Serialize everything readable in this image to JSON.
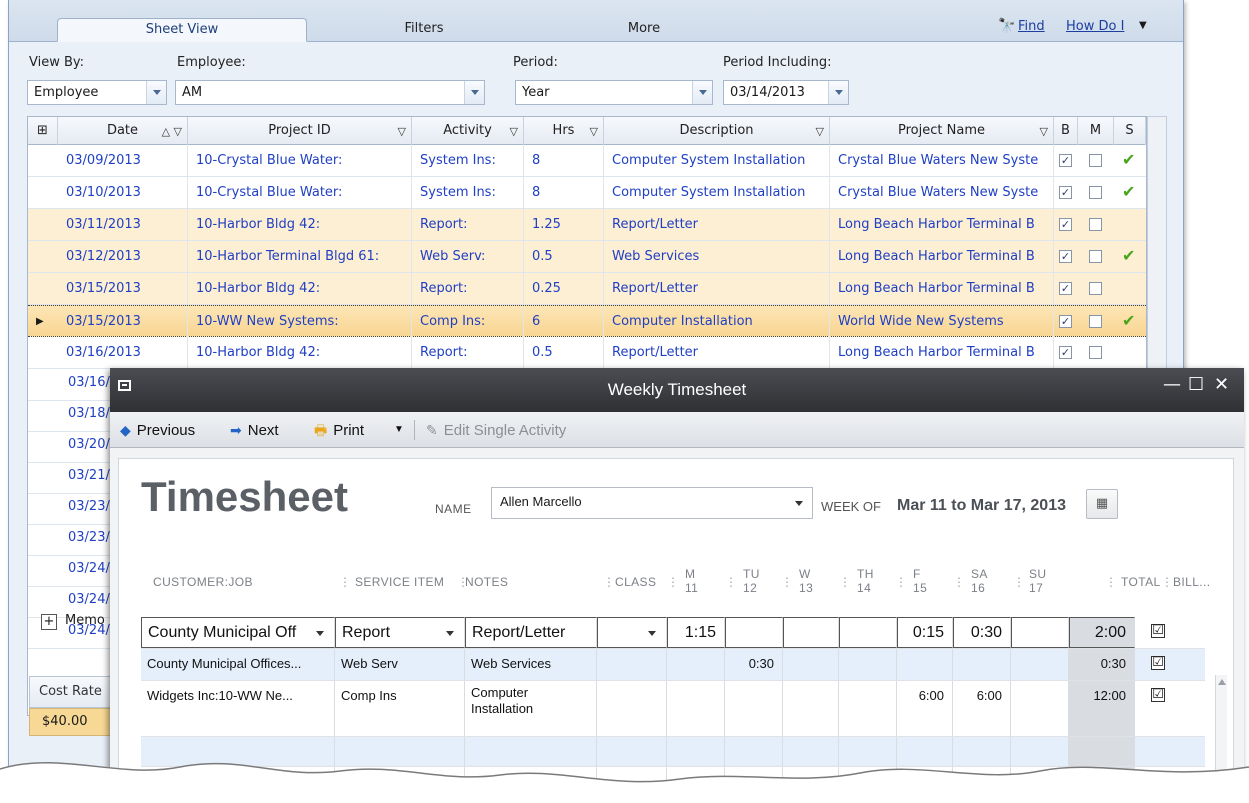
{
  "back": {
    "tabs": [
      "Sheet View",
      "Filters",
      "More"
    ],
    "find_label": "Find",
    "howdoi_label": "How Do I",
    "filters": {
      "view_by_label": "View By:",
      "view_by_value": "Employee",
      "employee_label": "Employee:",
      "employee_value": "AM",
      "period_label": "Period:",
      "period_value": "Year",
      "period_incl_label": "Period Including:",
      "period_incl_value": "03/14/2013"
    },
    "columns": [
      "Date",
      "Project ID",
      "Activity",
      "Hrs",
      "Description",
      "Project Name",
      "B",
      "M",
      "S"
    ],
    "rows": [
      {
        "date": "03/09/2013",
        "project_id": "10-Crystal Blue Water:",
        "activity": "System Ins:",
        "hrs": "8",
        "description": "Computer System Installation",
        "project_name": "Crystal Blue Waters New Syste"
      },
      {
        "date": "03/10/2013",
        "project_id": "10-Crystal Blue Water:",
        "activity": "System Ins:",
        "hrs": "8",
        "description": "Computer System Installation",
        "project_name": "Crystal Blue Waters New Syste"
      },
      {
        "date": "03/11/2013",
        "project_id": "10-Harbor Bldg 42:",
        "activity": "Report:",
        "hrs": "1.25",
        "description": "Report/Letter",
        "project_name": "Long Beach Harbor Terminal B"
      },
      {
        "date": "03/12/2013",
        "project_id": "10-Harbor Terminal Blgd 61:",
        "activity": "Web Serv:",
        "hrs": "0.5",
        "description": "Web Services",
        "project_name": "Long Beach Harbor Terminal B"
      },
      {
        "date": "03/15/2013",
        "project_id": "10-Harbor Bldg 42:",
        "activity": "Report:",
        "hrs": "0.25",
        "description": "Report/Letter",
        "project_name": "Long Beach Harbor Terminal B"
      },
      {
        "date": "03/15/2013",
        "project_id": "10-WW New Systems:",
        "activity": "Comp Ins:",
        "hrs": "6",
        "description": "Computer Installation",
        "project_name": "World Wide New Systems"
      },
      {
        "date": "03/16/2013",
        "project_id": "10-Harbor Bldg 42:",
        "activity": "Report:",
        "hrs": "0.5",
        "description": "Report/Letter",
        "project_name": "Long Beach Harbor Terminal B"
      }
    ],
    "partial_dates": [
      "03/16/",
      "03/18/",
      "03/20/",
      "03/21/",
      "03/23/",
      "03/23/",
      "03/24/",
      "03/24/",
      "03/24/"
    ],
    "memo_label": "Memo",
    "cost_rate_label": "Cost Rate",
    "cost_rate_value": "$40.00"
  },
  "front": {
    "window_title": "Weekly Timesheet",
    "toolbar": {
      "previous": "Previous",
      "next": "Next",
      "print": "Print",
      "edit_single": "Edit Single Activity"
    },
    "heading": "Timesheet",
    "name_label": "NAME",
    "name_value": "Allen Marcello",
    "week_of_label": "WEEK OF",
    "week_of_value": "Mar 11 to Mar 17, 2013",
    "columns": {
      "customer_job": "CUSTOMER:JOB",
      "service_item": "SERVICE ITEM",
      "notes": "NOTES",
      "class": "CLASS",
      "days": [
        {
          "d": "M",
          "n": "11"
        },
        {
          "d": "TU",
          "n": "12"
        },
        {
          "d": "W",
          "n": "13"
        },
        {
          "d": "TH",
          "n": "14"
        },
        {
          "d": "F",
          "n": "15"
        },
        {
          "d": "SA",
          "n": "16"
        },
        {
          "d": "SU",
          "n": "17"
        }
      ],
      "total": "TOTAL",
      "billable": "BILL..."
    },
    "rows": [
      {
        "customer": "County Municipal Off",
        "service": "Report",
        "notes": "Report/Letter",
        "class": "",
        "m": "1:15",
        "tu": "",
        "w": "",
        "th": "",
        "f": "0:15",
        "sa": "0:30",
        "su": "",
        "total": "2:00",
        "billable": "☑"
      },
      {
        "customer": "County Municipal Offices...",
        "service": "Web Serv",
        "notes": "Web Services",
        "class": "",
        "m": "",
        "tu": "0:30",
        "w": "",
        "th": "",
        "f": "",
        "sa": "",
        "su": "",
        "total": "0:30",
        "billable": "☑"
      },
      {
        "customer": "Widgets Inc:10-WW Ne...",
        "service": "Comp Ins",
        "notes": "Computer Installation",
        "class": "",
        "m": "",
        "tu": "",
        "w": "",
        "th": "",
        "f": "6:00",
        "sa": "6:00",
        "su": "",
        "total": "12:00",
        "billable": "☑"
      }
    ]
  }
}
